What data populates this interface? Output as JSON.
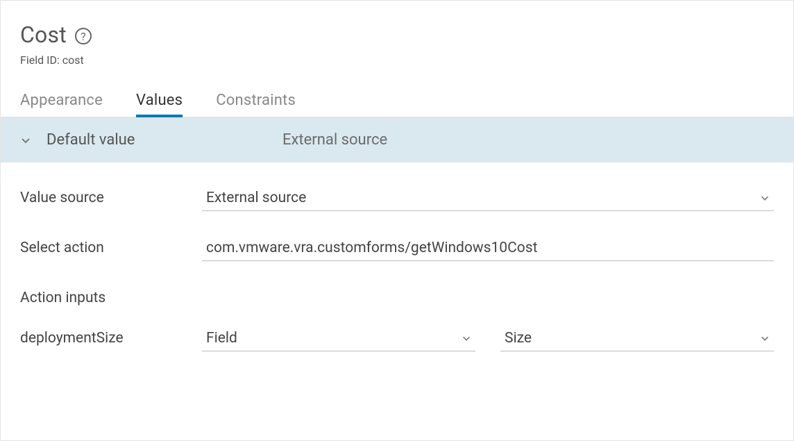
{
  "header": {
    "title": "Cost",
    "field_id_label": "Field ID: cost"
  },
  "tabs": {
    "appearance": "Appearance",
    "values": "Values",
    "constraints": "Constraints"
  },
  "section": {
    "label": "Default value",
    "value": "External source"
  },
  "form": {
    "value_source": {
      "label": "Value source",
      "value": "External source"
    },
    "select_action": {
      "label": "Select action",
      "value": "com.vmware.vra.customforms/getWindows10Cost"
    },
    "action_inputs": {
      "label": "Action inputs"
    },
    "deployment_size": {
      "label": "deploymentSize",
      "type_value": "Field",
      "field_value": "Size"
    }
  }
}
